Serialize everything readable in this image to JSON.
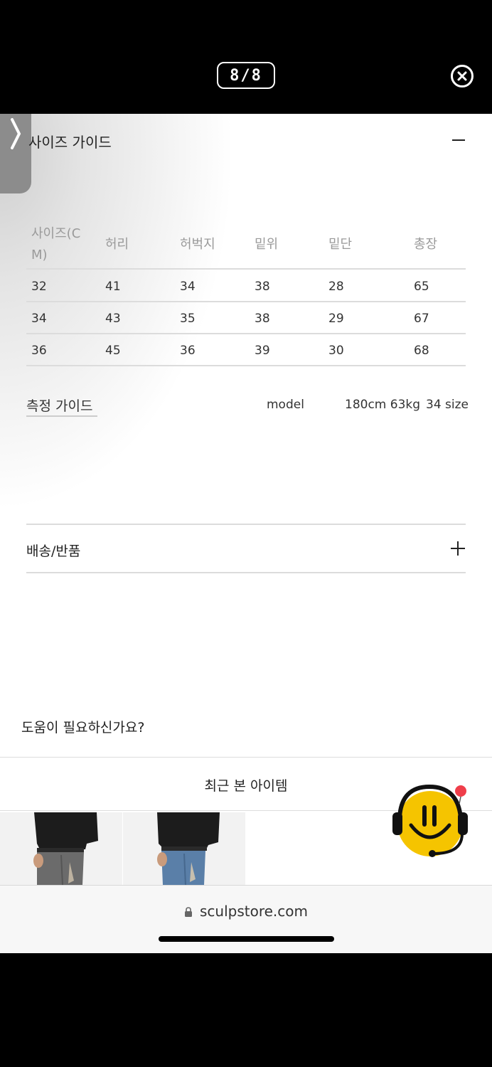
{
  "viewer": {
    "page_counter": "8/8",
    "close_icon": "close-circle-icon",
    "prev_icon": "chevron-right-icon"
  },
  "size_guide": {
    "title": "사이즈 가이드",
    "toggle_icon": "minus-icon",
    "columns": [
      "사이즈(CM)",
      "허리",
      "허벅지",
      "밑위",
      "밑단",
      "총장"
    ],
    "rows": [
      [
        "32",
        "41",
        "34",
        "38",
        "28",
        "65"
      ],
      [
        "34",
        "43",
        "35",
        "38",
        "29",
        "67"
      ],
      [
        "36",
        "45",
        "36",
        "39",
        "30",
        "68"
      ]
    ]
  },
  "measure": {
    "title": "측정 가이드",
    "model_label": "model",
    "model_body": "180cm 63kg",
    "model_size": "34 size"
  },
  "shipping": {
    "title": "배송/반품",
    "toggle_icon": "plus-icon"
  },
  "help": {
    "text": "도움이 필요하신가요?"
  },
  "recent": {
    "title": "최근 본 아이템",
    "items": [
      {
        "description": "black tee with washed grey jeans"
      },
      {
        "description": "black tee with blue jeans"
      }
    ]
  },
  "chatbot": {
    "icon": "smiley-headset-icon"
  },
  "browser": {
    "url": "sculpstore.com",
    "lock_icon": "lock-icon"
  },
  "colors": {
    "background": "#ffffff",
    "text": "#222222",
    "muted": "#9a9a9a",
    "divider": "#dcdcdc",
    "chatbot_yellow": "#f5c400"
  }
}
